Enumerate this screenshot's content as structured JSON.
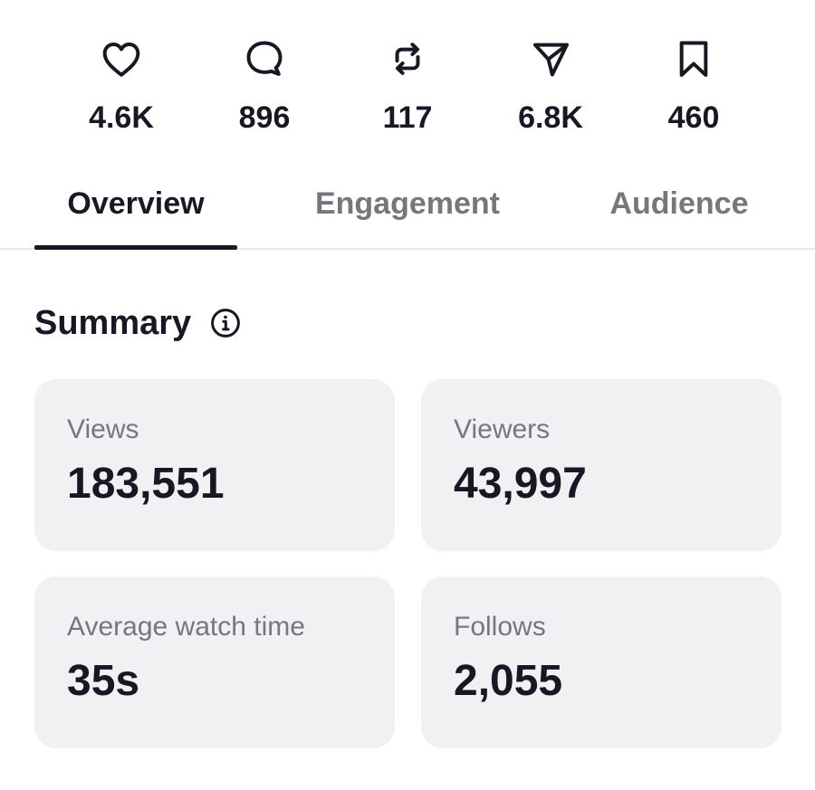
{
  "stats": [
    {
      "icon": "heart-icon",
      "count": "4.6K"
    },
    {
      "icon": "comment-icon",
      "count": "896"
    },
    {
      "icon": "repost-icon",
      "count": "117"
    },
    {
      "icon": "share-icon",
      "count": "6.8K"
    },
    {
      "icon": "bookmark-icon",
      "count": "460"
    }
  ],
  "tabs": [
    {
      "label": "Overview",
      "active": true
    },
    {
      "label": "Engagement",
      "active": false
    },
    {
      "label": "Audience",
      "active": false
    }
  ],
  "summary": {
    "title": "Summary",
    "info_icon": "info-icon",
    "cards": [
      {
        "label": "Views",
        "value": "183,551"
      },
      {
        "label": "Viewers",
        "value": "43,997"
      },
      {
        "label": "Average watch time",
        "value": "35s"
      },
      {
        "label": "Follows",
        "value": "2,055"
      }
    ]
  },
  "colors": {
    "text_primary": "#161823",
    "text_secondary": "#75777d",
    "card_background": "#f1f1f4",
    "divider": "#e9e9eb"
  }
}
